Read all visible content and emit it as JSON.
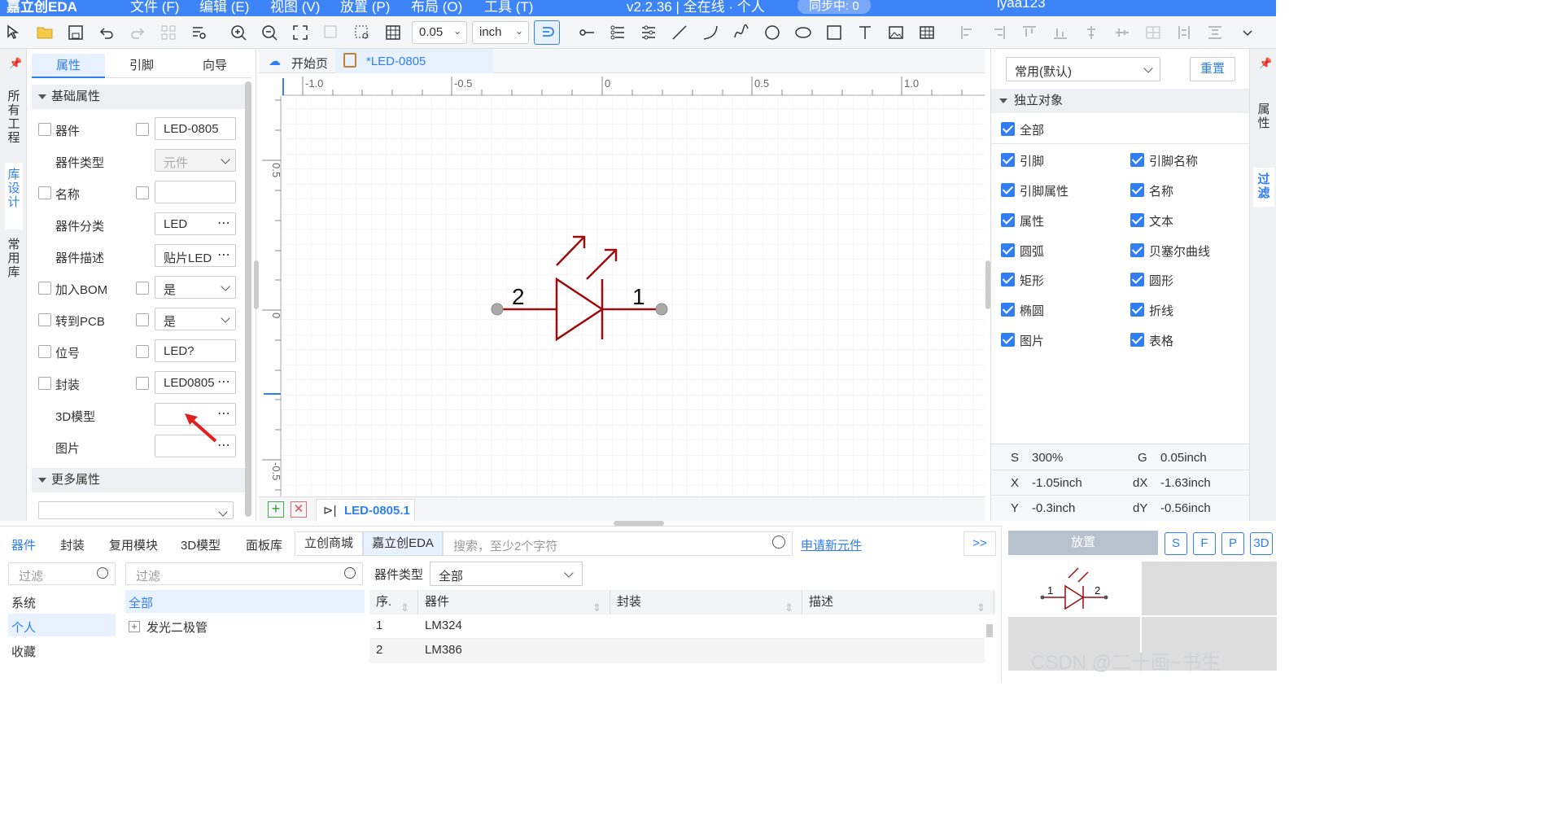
{
  "menubar": {
    "app_title": "嘉立创EDA",
    "items": [
      "文件 (F)",
      "编辑 (E)",
      "视图 (V)",
      "放置 (P)",
      "布局 (O)",
      "工具 (T)"
    ],
    "version": "v2.2.36 | 全在线 · 个人",
    "sync": "同步中: 0",
    "user": "lyaa123"
  },
  "toolbar": {
    "grid_value": "0.05",
    "unit_value": "inch"
  },
  "left_strip": {
    "tabs": [
      "所有工程",
      "库设计",
      "常用库"
    ]
  },
  "left_panel": {
    "tabs": [
      "属性",
      "引脚",
      "向导"
    ],
    "section_basic": "基础属性",
    "section_more": "更多属性",
    "rows": [
      {
        "label": "器件",
        "value": "LED-0805"
      },
      {
        "label": "器件类型",
        "value": "元件"
      },
      {
        "label": "名称",
        "value": ""
      },
      {
        "label": "器件分类",
        "value": "LED"
      },
      {
        "label": "器件描述",
        "value": "贴片LED"
      },
      {
        "label": "加入BOM",
        "value": "是"
      },
      {
        "label": "转到PCB",
        "value": "是"
      },
      {
        "label": "位号",
        "value": "LED?"
      },
      {
        "label": "封装",
        "value": "LED0805"
      },
      {
        "label": "3D模型",
        "value": ""
      },
      {
        "label": "图片",
        "value": ""
      }
    ]
  },
  "doc_tabs": {
    "home": "开始页",
    "active": "*LED-0805"
  },
  "ruler": {
    "x_ticks": [
      "-1.0",
      "-0.5",
      "0",
      "0.5",
      "1.0"
    ],
    "y_ticks": [
      "0.5",
      "0",
      "-0.5"
    ]
  },
  "symbol": {
    "pin_left": "2",
    "pin_right": "1"
  },
  "bottom_tabs": {
    "sheet": "LED-0805.1"
  },
  "right_panel": {
    "filter_select": "常用(默认)",
    "reset_button": "重置",
    "section": "独立对象",
    "all_label": "全部",
    "filters": [
      "引脚",
      "引脚名称",
      "引脚属性",
      "名称",
      "属性",
      "文本",
      "圆弧",
      "贝塞尔曲线",
      "矩形",
      "圆形",
      "椭圆",
      "折线",
      "图片",
      "表格"
    ],
    "stats": {
      "S_label": "S",
      "S_value": "300%",
      "G_label": "G",
      "G_value": "0.05inch",
      "X_label": "X",
      "X_value": "-1.05inch",
      "dX_label": "dX",
      "dX_value": "-1.63inch",
      "Y_label": "Y",
      "Y_value": "-0.3inch",
      "dY_label": "dY",
      "dY_value": "-0.56inch"
    }
  },
  "right_strip": {
    "tabs": [
      "属性",
      "过滤"
    ]
  },
  "library": {
    "tabs": [
      "器件",
      "封装",
      "复用模块",
      "3D模型",
      "面板库"
    ],
    "sources": [
      "立创商城",
      "嘉立创EDA"
    ],
    "search_placeholder": "搜索，至少2个字符",
    "apply_link": "申请新元件",
    "more_button": ">>",
    "filter_placeholder_1": "过滤",
    "filter_placeholder_2": "过滤",
    "left_list": [
      "系统",
      "个人",
      "收藏"
    ],
    "category_all": "全部",
    "category_item": "发光二极管",
    "type_label": "器件类型",
    "type_value": "全部",
    "columns": [
      "序.",
      "器件",
      "封装",
      "描述"
    ],
    "rows": [
      {
        "no": "1",
        "name": "LM324"
      },
      {
        "no": "2",
        "name": "LM386"
      }
    ]
  },
  "preview": {
    "place_button": "放置",
    "buttons": [
      "S",
      "F",
      "P",
      "3D"
    ],
    "pin_left": "1",
    "pin_right": "2"
  },
  "watermark": "CSDN @二十画~书生"
}
